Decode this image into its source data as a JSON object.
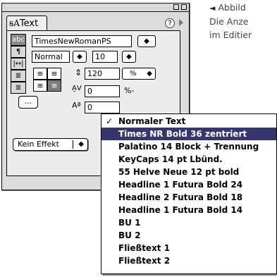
{
  "caption": {
    "arrow": "◄",
    "line1": "Abbild",
    "line2": "Die Anze",
    "line3": "im Editier"
  },
  "palette": {
    "tab_label": "Text",
    "help_label": "?",
    "modes": [
      "abc",
      "¶",
      "|↔|",
      "≣",
      "≣"
    ],
    "font_name": "TimesNewRomanPS",
    "font_style": "Normal",
    "font_size": "10",
    "leading_value": "120",
    "leading_unit": "%",
    "tracking_value": "0",
    "tracking_unit": "%-",
    "baseline_value": "0",
    "dots_label": "...",
    "effect_label": "Kein Effekt",
    "stepper_glyph": "◆",
    "align_left": "≡",
    "align_center": "≡"
  },
  "menu": {
    "items": [
      {
        "label": "Normaler Text",
        "checked": true
      },
      {
        "label": "Times NR Bold 36 zentriert",
        "selected": true
      },
      {
        "label": "Palatino 14 Block + Trennung"
      },
      {
        "label": "KeyCaps 14 pt Lbünd."
      },
      {
        "label": "55 Helve Neue 12 pt bold"
      },
      {
        "label": "Headline 1 Futura Bold 24"
      },
      {
        "label": "Headline 2 Futura Bold 18"
      },
      {
        "label": "Headline 1 Futura Bold 14"
      },
      {
        "label": "BU 1"
      },
      {
        "label": "BU 2"
      },
      {
        "label": "Fließtext 1"
      },
      {
        "label": "Fließtext 2"
      }
    ],
    "check_glyph": "✓",
    "selected_color": "#36366e"
  }
}
